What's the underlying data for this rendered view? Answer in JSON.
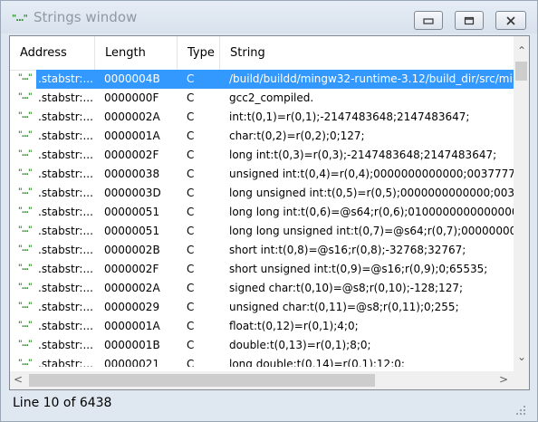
{
  "window": {
    "title": "Strings window",
    "icon": "strings-icon"
  },
  "columns": [
    "Address",
    "Length",
    "Type",
    "String"
  ],
  "rows": [
    {
      "icon": "\"...\"",
      "address": ".stabstr:...",
      "length": "0000004B",
      "type": "C",
      "string": "/build/buildd/mingw32-runtime-3.12/build_dir/src/mi"
    },
    {
      "icon": "\"...\"",
      "address": ".stabstr:...",
      "length": "0000000F",
      "type": "C",
      "string": "gcc2_compiled."
    },
    {
      "icon": "\"...\"",
      "address": ".stabstr:...",
      "length": "0000002A",
      "type": "C",
      "string": "int:t(0,1)=r(0,1);-2147483648;2147483647;"
    },
    {
      "icon": "\"...\"",
      "address": ".stabstr:...",
      "length": "0000001A",
      "type": "C",
      "string": "char:t(0,2)=r(0,2);0;127;"
    },
    {
      "icon": "\"...\"",
      "address": ".stabstr:...",
      "length": "0000002F",
      "type": "C",
      "string": "long int:t(0,3)=r(0,3);-2147483648;2147483647;"
    },
    {
      "icon": "\"...\"",
      "address": ".stabstr:...",
      "length": "00000038",
      "type": "C",
      "string": "unsigned int:t(0,4)=r(0,4);0000000000000;00377777"
    },
    {
      "icon": "\"...\"",
      "address": ".stabstr:...",
      "length": "0000003D",
      "type": "C",
      "string": "long unsigned int:t(0,5)=r(0,5);0000000000000;0037"
    },
    {
      "icon": "\"...\"",
      "address": ".stabstr:...",
      "length": "00000051",
      "type": "C",
      "string": "long long int:t(0,6)=@s64;r(0,6);01000000000000000"
    },
    {
      "icon": "\"...\"",
      "address": ".stabstr:...",
      "length": "00000051",
      "type": "C",
      "string": "long long unsigned int:t(0,7)=@s64;r(0,7);000000000"
    },
    {
      "icon": "\"...\"",
      "address": ".stabstr:...",
      "length": "0000002B",
      "type": "C",
      "string": "short int:t(0,8)=@s16;r(0,8);-32768;32767;"
    },
    {
      "icon": "\"...\"",
      "address": ".stabstr:...",
      "length": "0000002F",
      "type": "C",
      "string": "short unsigned int:t(0,9)=@s16;r(0,9);0;65535;"
    },
    {
      "icon": "\"...\"",
      "address": ".stabstr:...",
      "length": "0000002A",
      "type": "C",
      "string": "signed char:t(0,10)=@s8;r(0,10);-128;127;"
    },
    {
      "icon": "\"...\"",
      "address": ".stabstr:...",
      "length": "00000029",
      "type": "C",
      "string": "unsigned char:t(0,11)=@s8;r(0,11);0;255;"
    },
    {
      "icon": "\"...\"",
      "address": ".stabstr:...",
      "length": "0000001A",
      "type": "C",
      "string": "float:t(0,12)=r(0,1);4;0;"
    },
    {
      "icon": "\"...\"",
      "address": ".stabstr:...",
      "length": "0000001B",
      "type": "C",
      "string": "double:t(0,13)=r(0,1);8;0;"
    },
    {
      "icon": "\"...\"",
      "address": ".stabstr:...",
      "length": "00000021",
      "type": "C",
      "string": "long double:t(0,14)=r(0,1);12;0;"
    }
  ],
  "selected_row": 0,
  "status": "Line 10 of 6438",
  "colors": {
    "selection": "#3399ff",
    "icon_green": "#2f8a2a"
  }
}
